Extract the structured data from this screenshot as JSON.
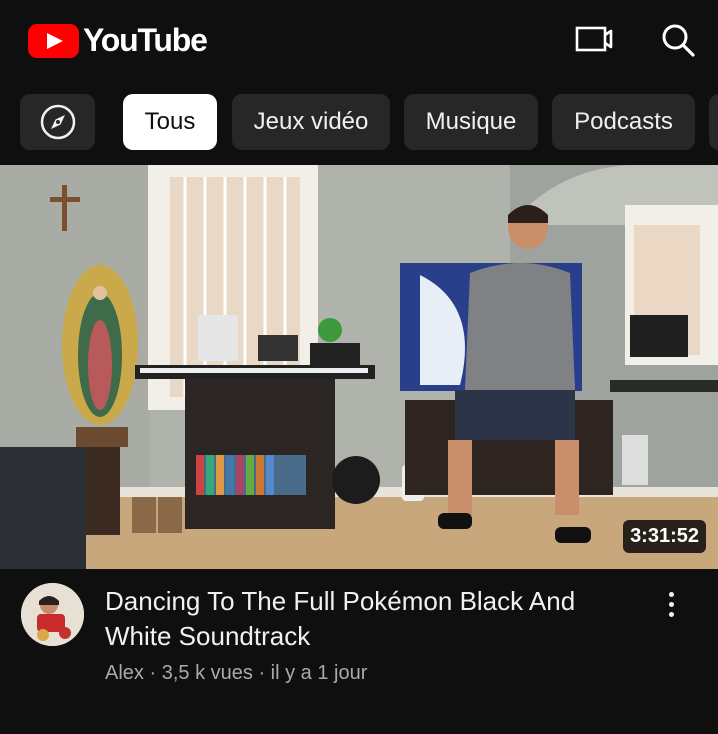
{
  "header": {
    "logo_text": "YouTube",
    "logo_icon": "youtube-play-icon",
    "cast_icon": "cast-icon",
    "search_icon": "search-icon"
  },
  "chips": {
    "explore_icon": "compass-icon",
    "items": [
      {
        "label": "Tous",
        "active": true
      },
      {
        "label": "Jeux vidéo",
        "active": false
      },
      {
        "label": "Musique",
        "active": false
      },
      {
        "label": "Podcasts",
        "active": false
      }
    ]
  },
  "video": {
    "duration": "3:31:52",
    "title": "Dancing To The Full Pokémon Black And White Soundtrack",
    "channel": "Alex",
    "views": "3,5 k vues",
    "age": "il y a 1 jour",
    "separator": "·",
    "more_icon": "more-vert-icon"
  },
  "colors": {
    "background": "#0f0f0f",
    "chip": "#272727",
    "chip_active": "#ffffff",
    "brand_red": "#ff0000",
    "meta_text": "#aaaaaa"
  }
}
